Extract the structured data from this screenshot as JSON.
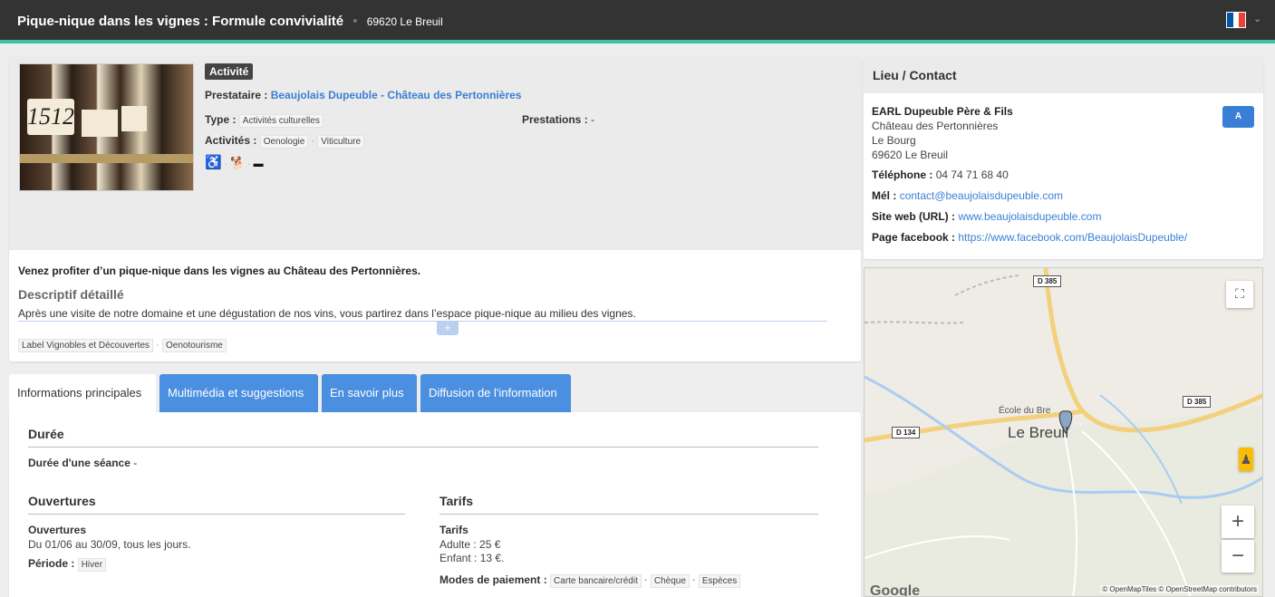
{
  "header": {
    "title": "Pique-nique dans les vignes : Formule convivialité",
    "separator": "•",
    "city": "69620 Le Breuil",
    "language_flag": "flag-fr-icon",
    "chevron": "⌄"
  },
  "product": {
    "badge": "Activité",
    "provider_label": "Prestataire :",
    "provider_name": "Beaujolais Dupeuble - Château des Pertonnières",
    "type_label": "Type :",
    "type_value": "Activités culturelles",
    "activities_label": "Activités :",
    "activities": [
      "Oenologie",
      "Viticulture"
    ],
    "services_label": "Prestations :",
    "services_value": "-",
    "photo_text": "1512",
    "icons": [
      "wheelchair-icon",
      "pets-icon",
      "payment-card-icon"
    ],
    "icon_glyphs": [
      "♿",
      "🐕",
      "▬"
    ]
  },
  "description": {
    "intro": "Venez profiter d’un pique-nique dans les vignes au Château des Pertonnières.",
    "detail_heading": "Descriptif détaillé",
    "detail_text": "Après une visite de notre domaine et une dégustation de nos vins, vous partirez dans l’espace pique-nique au milieu des vignes.",
    "expand": "+",
    "labels": [
      "Label Vignobles et Découvertes",
      "Oenotourisme"
    ]
  },
  "tabs": [
    {
      "label": "Informations principales",
      "active": true
    },
    {
      "label": "Multimédia et suggestions",
      "active": false
    },
    {
      "label": "En savoir plus",
      "active": false
    },
    {
      "label": "Diffusion de l'information",
      "active": false
    }
  ],
  "info": {
    "duration_heading": "Durée",
    "duration_label": "Durée d'une séance",
    "duration_value": "-",
    "openings_heading": "Ouvertures",
    "openings_label": "Ouvertures",
    "openings_value": "Du 01/06 au 30/09, tous les jours.",
    "period_label": "Période :",
    "period_value": "Hiver",
    "rates_heading": "Tarifs",
    "rates_label": "Tarifs",
    "rate_adult": "Adulte : 25 €",
    "rate_child": "Enfant : 13 €.",
    "payment_label": "Modes de paiement :",
    "payment_methods": [
      "Carte bancaire/crédit",
      "Chèque",
      "Espèces"
    ]
  },
  "contact": {
    "heading": "Lieu / Contact",
    "name": "EARL Dupeuble Père & Fils",
    "address1": "Château des Pertonnières",
    "address2": "Le Bourg",
    "address3": "69620 Le Breuil",
    "phone_label": "Téléphone :",
    "phone": "04 74 71 68 40",
    "email_label": "Mél :",
    "email": "contact@beaujolaisdupeuble.com",
    "website_label": "Site web (URL) :",
    "website": "www.beaujolaisdupeuble.com",
    "facebook_label": "Page facebook :",
    "facebook": "https://www.facebook.com/BeaujolaisDupeuble/",
    "route_button": "A"
  },
  "map": {
    "town": "Le Breuil",
    "school": "École du Bre",
    "roads": [
      "D 385",
      "D 385",
      "D 134"
    ],
    "zoom_in": "+",
    "zoom_out": "−",
    "attribution": "© OpenMapTiles © OpenStreetMap contributors",
    "google": "Google",
    "colors": {
      "water": "#a9cdf2",
      "road_major": "#f7d88c",
      "land": "#efece6",
      "forest": "#d9e8cf"
    }
  }
}
